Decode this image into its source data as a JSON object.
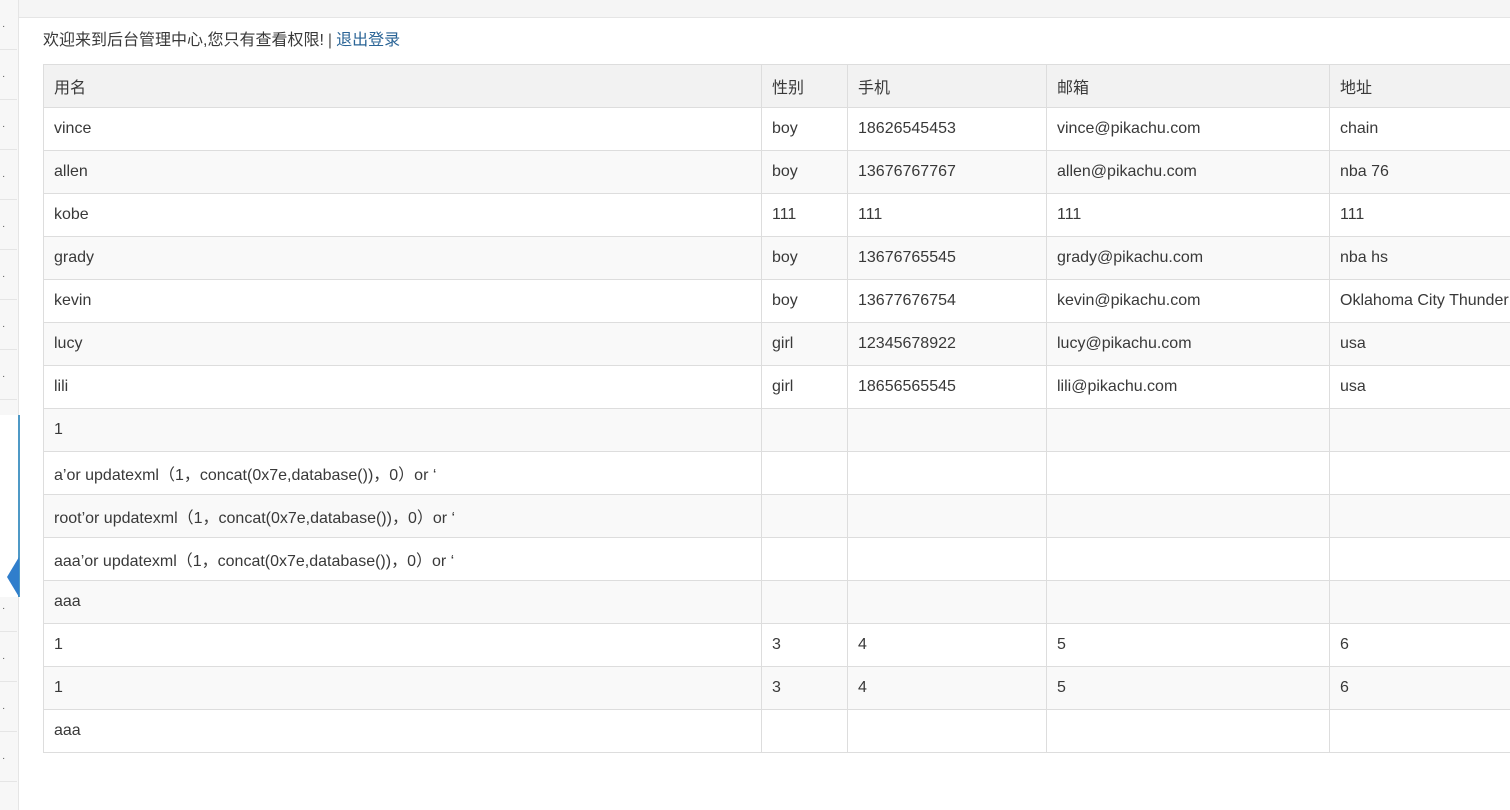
{
  "header": {
    "welcome_text": "欢迎来到后台管理中心,您只有查看权限!",
    "separator": "|",
    "logout_label": "退出登录"
  },
  "table": {
    "columns": [
      "用名",
      "性别",
      "手机",
      "邮箱",
      "地址"
    ],
    "rows": [
      [
        "vince",
        "boy",
        "18626545453",
        "vince@pikachu.com",
        "chain"
      ],
      [
        "allen",
        "boy",
        "13676767767",
        "allen@pikachu.com",
        "nba 76"
      ],
      [
        "kobe",
        "111",
        "111",
        "111",
        "111"
      ],
      [
        "grady",
        "boy",
        "13676765545",
        "grady@pikachu.com",
        "nba hs"
      ],
      [
        "kevin",
        "boy",
        "13677676754",
        "kevin@pikachu.com",
        "Oklahoma City Thunder"
      ],
      [
        "lucy",
        "girl",
        "12345678922",
        "lucy@pikachu.com",
        "usa"
      ],
      [
        "lili",
        "girl",
        "18656565545",
        "lili@pikachu.com",
        "usa"
      ],
      [
        "1",
        "",
        "",
        "",
        ""
      ],
      [
        "a’or updatexml（1，concat(0x7e,database())，0）or ‘",
        "",
        "",
        "",
        ""
      ],
      [
        "root’or updatexml（1，concat(0x7e,database())，0）or ‘",
        "",
        "",
        "",
        ""
      ],
      [
        "aaa’or updatexml（1，concat(0x7e,database())，0）or ‘",
        "",
        "",
        "",
        ""
      ],
      [
        "aaa",
        "",
        "",
        "",
        ""
      ],
      [
        "1",
        "3",
        "4",
        "5",
        "6"
      ],
      [
        "1",
        "3",
        "4",
        "5",
        "6"
      ],
      [
        "aaa",
        "",
        "",
        "",
        ""
      ]
    ]
  },
  "sidebar": {
    "collapse_icon": "chevron-left-icon",
    "accent_color": "#307ecc"
  }
}
